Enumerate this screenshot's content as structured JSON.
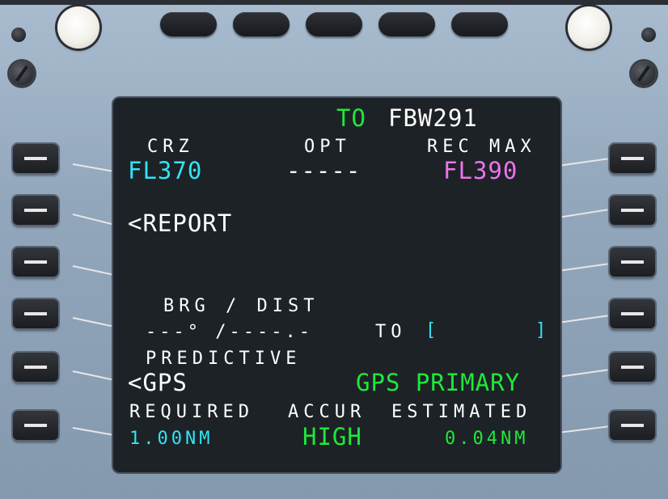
{
  "mcdu": {
    "title_prefix": "TO",
    "title_flight": "FBW291",
    "crz_label": "CRZ",
    "crz_value": "FL370",
    "opt_label": "OPT",
    "opt_value": "-----",
    "recmax_label": "REC MAX",
    "recmax_value": "FL390",
    "report": "<REPORT",
    "brg_dist_label": "BRG / DIST",
    "brg_dist_value": "---° /----.-",
    "to_label": "TO",
    "to_bracket_open": "[",
    "to_bracket_close": "]",
    "predictive_label": "PREDICTIVE",
    "gps": "<GPS",
    "gps_status": "GPS PRIMARY",
    "required_label": "REQUIRED",
    "accur_label": "ACCUR",
    "estimated_label": "ESTIMATED",
    "required_value": "1.00NM",
    "accur_value": "HIGH",
    "estimated_value": "0.04NM"
  },
  "colors": {
    "white": "#ffffff",
    "green": "#1fe83a",
    "cyan": "#31e4f5",
    "magenta": "#ec74ee",
    "screen": "#1d2226"
  }
}
